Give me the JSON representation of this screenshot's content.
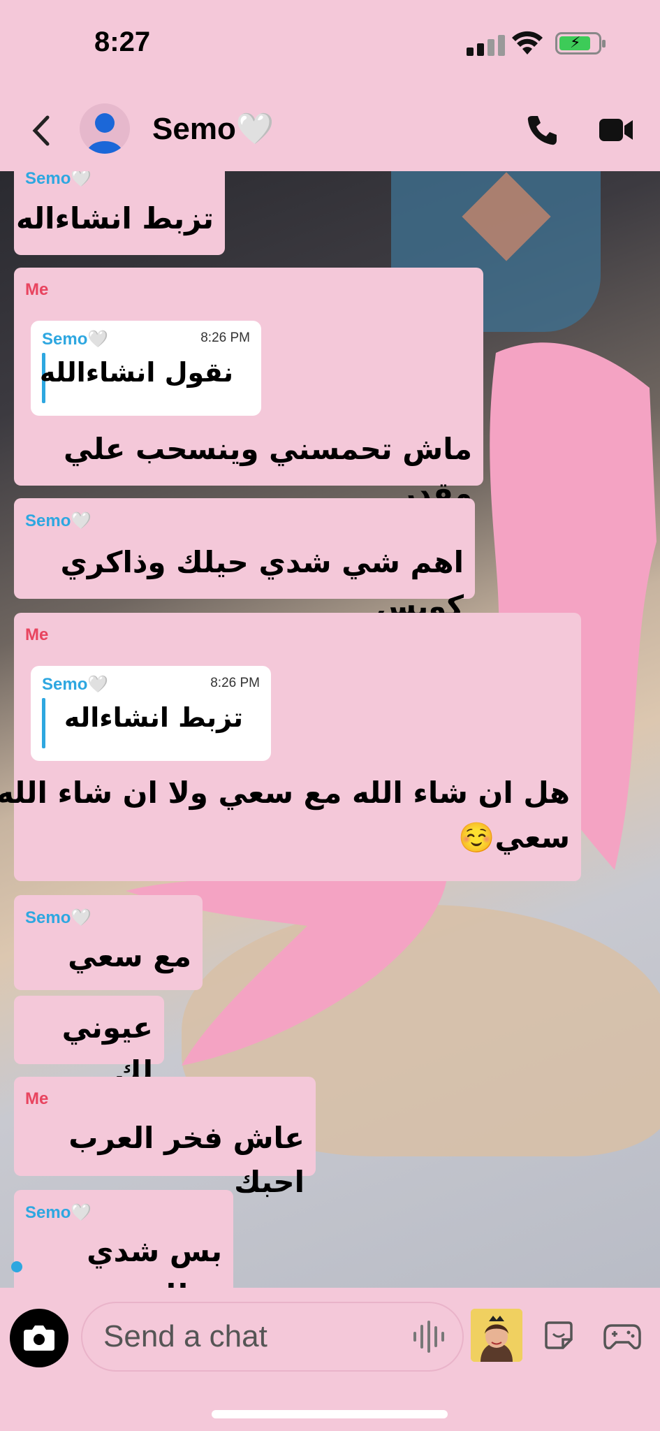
{
  "status_bar": {
    "time": "8:27"
  },
  "header": {
    "title": "Semo🤍"
  },
  "messages": [
    {
      "sender": "Semo🤍",
      "text": "تزبط انشاءاله"
    },
    {
      "sender": "Me",
      "quote": {
        "sender": "Semo🤍",
        "time": "8:26 PM",
        "text": "نقول انشاءالله"
      },
      "text": "ماش تحمسني وينسحب علي مقدر"
    },
    {
      "sender": "Semo🤍",
      "text": "اهم شي شدي حيلك وذاكري كويس"
    },
    {
      "sender": "Me",
      "quote": {
        "sender": "Semo🤍",
        "time": "8:26 PM",
        "text": "تزبط انشاءاله"
      },
      "text_line1": "هل ان شاء الله مع سعي ولا ان شاء الله بدون",
      "text_line2": "سعي☺️"
    },
    {
      "sender": "Semo🤍",
      "text": "مع سعي",
      "text2": "عيوني لك"
    },
    {
      "sender": "Me",
      "text": "عاش فخر العرب احبك"
    },
    {
      "sender": "Semo🤍",
      "text": "بس شدي حيلك"
    }
  ],
  "composer": {
    "placeholder": "Send a chat"
  },
  "icons": {
    "back": "chevron-left-icon",
    "call": "phone-icon",
    "video": "video-camera-icon",
    "camera": "camera-icon",
    "mic": "voice-wave-icon",
    "sticker": "sticker-icon",
    "game": "gamepad-icon"
  },
  "colors": {
    "background": "#f4c8d9",
    "semo": "#2ea7e0",
    "me": "#e8445f"
  }
}
